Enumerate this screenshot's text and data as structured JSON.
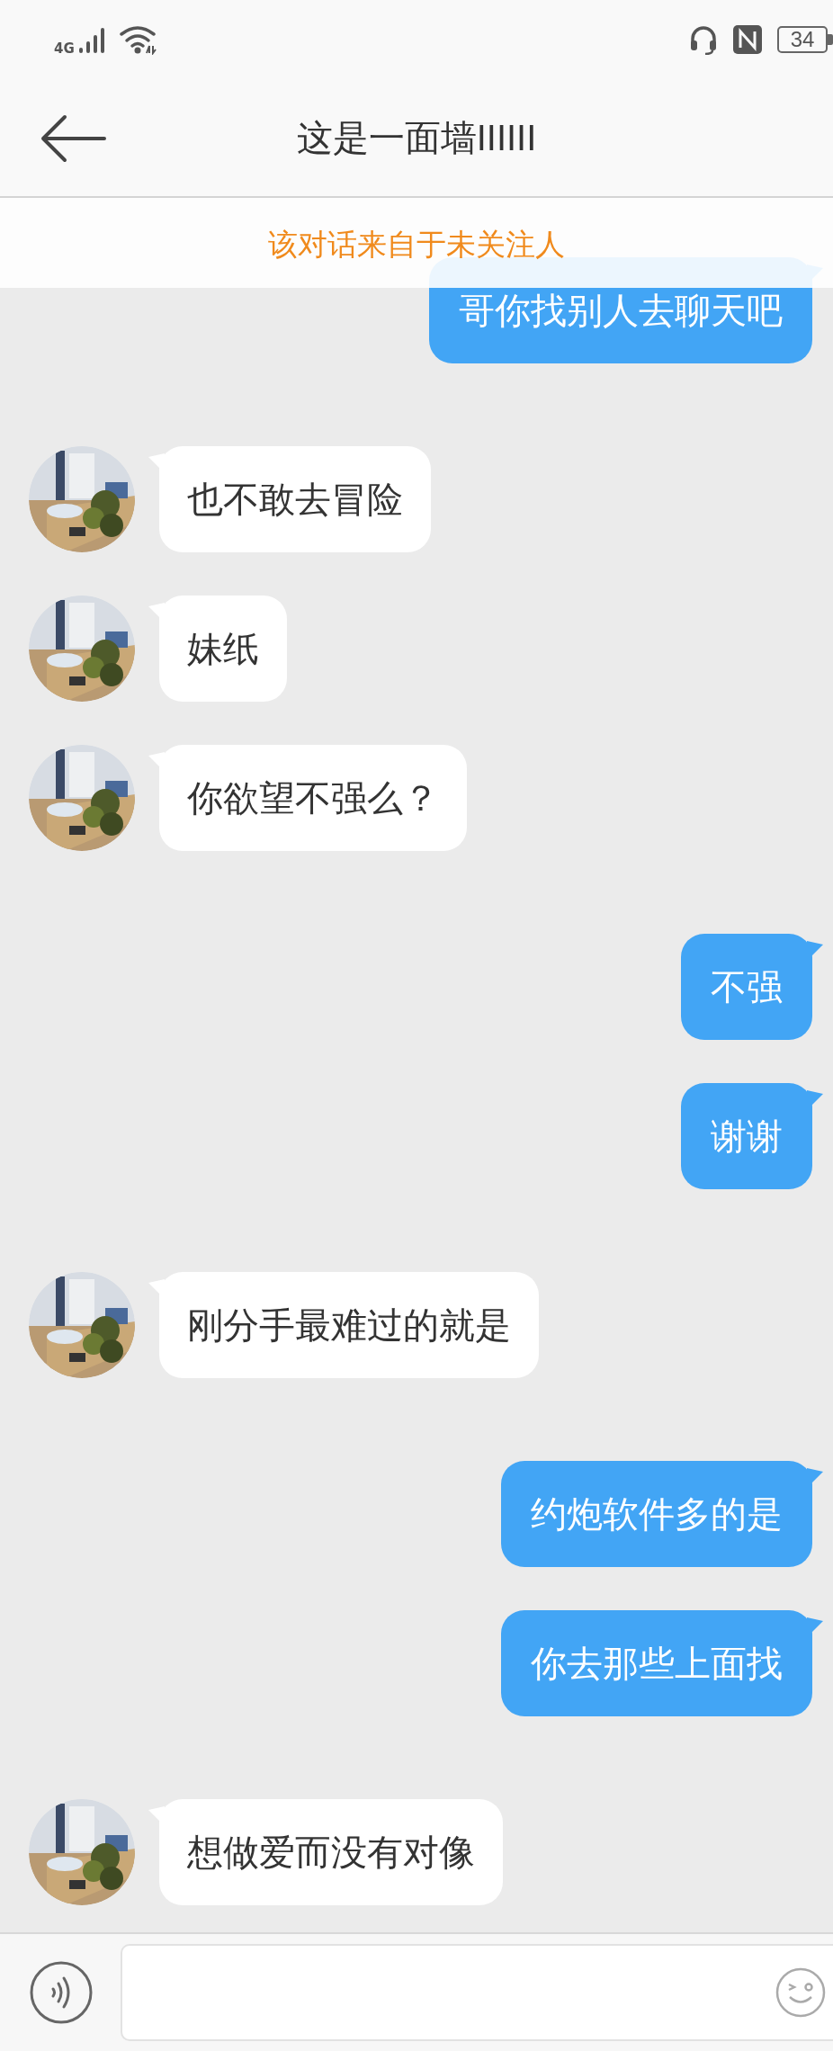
{
  "status_bar": {
    "network": "4G",
    "battery": "34"
  },
  "header": {
    "title": "这是一面墙IIIIII"
  },
  "notice": "该对话来自于未关注人",
  "messages": [
    {
      "kind": "sent",
      "text": "哥你找别人去聊天吧"
    },
    {
      "kind": "received",
      "text": "也不敢去冒险"
    },
    {
      "kind": "received",
      "text": "妹纸"
    },
    {
      "kind": "received",
      "text": "你欲望不强么？"
    },
    {
      "kind": "sent",
      "text": "不强"
    },
    {
      "kind": "sent",
      "text": "谢谢"
    },
    {
      "kind": "received",
      "text": "刚分手最难过的就是"
    },
    {
      "kind": "sent",
      "text": "约炮软件多的是"
    },
    {
      "kind": "sent",
      "text": "你去那些上面找"
    },
    {
      "kind": "received",
      "text": "想做爱而没有对像"
    }
  ]
}
